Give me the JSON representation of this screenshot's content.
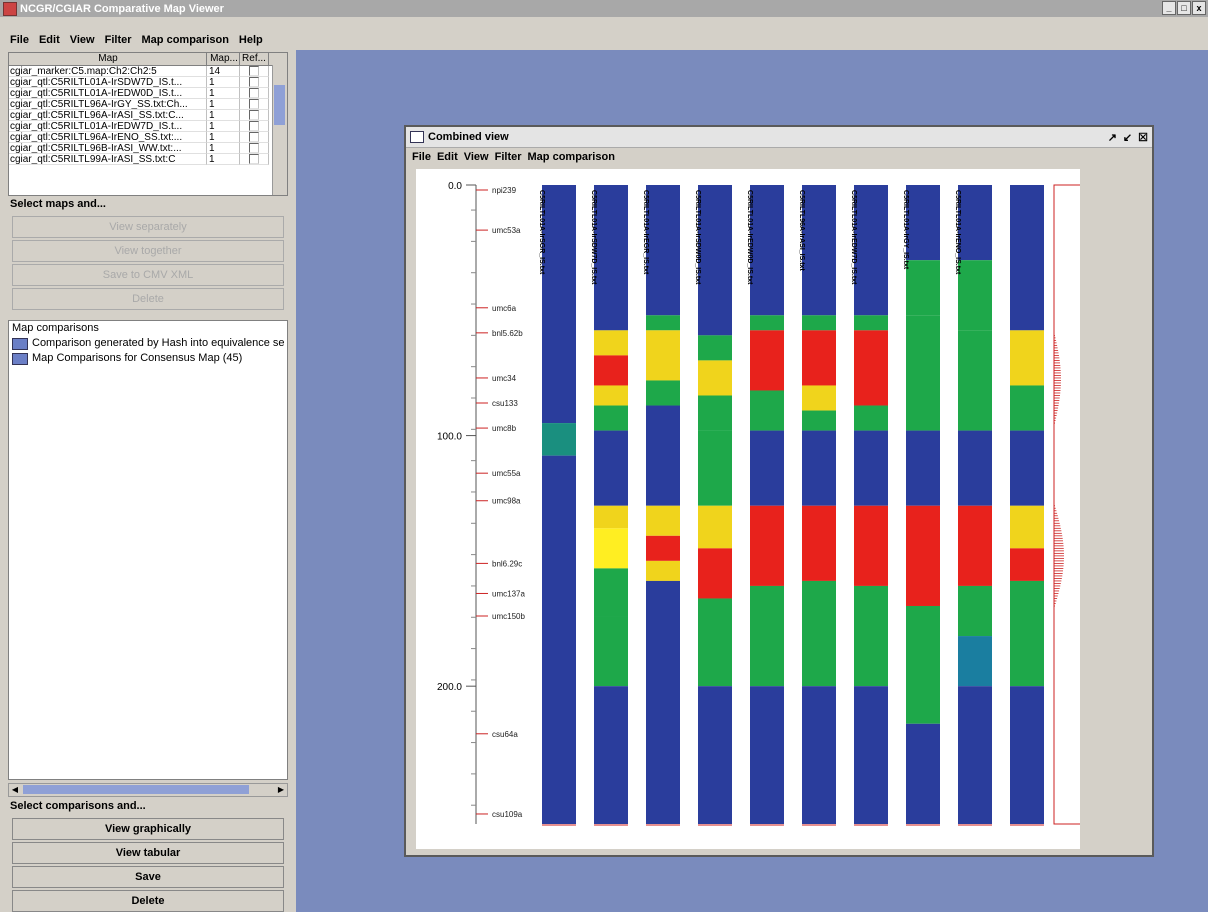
{
  "app": {
    "title": "NCGR/CGIAR Comparative Map Viewer",
    "window_controls": [
      "_",
      "□",
      "x"
    ]
  },
  "menu": [
    "File",
    "Edit",
    "View",
    "Filter",
    "Map comparison",
    "Help"
  ],
  "maps_table": {
    "columns": [
      "Map",
      "Map...",
      "Ref..."
    ],
    "rows": [
      {
        "map": "cgiar_marker:C5.map:Ch2:Ch2:5",
        "count": "14"
      },
      {
        "map": "cgiar_qtl:C5RILTL01A-IrSDW7D_IS.t...",
        "count": "1"
      },
      {
        "map": "cgiar_qtl:C5RILTL01A-IrEDW0D_IS.t...",
        "count": "1"
      },
      {
        "map": "cgiar_qtl:C5RILTL96A-IrGY_SS.txt:Ch...",
        "count": "1"
      },
      {
        "map": "cgiar_qtl:C5RILTL96A-IrASI_SS.txt:C...",
        "count": "1"
      },
      {
        "map": "cgiar_qtl:C5RILTL01A-IrEDW7D_IS.t...",
        "count": "1"
      },
      {
        "map": "cgiar_qtl:C5RILTL96A-IrENO_SS.txt:...",
        "count": "1"
      },
      {
        "map": "cgiar_qtl:C5RILTL96B-IrASI_WW.txt:...",
        "count": "1"
      },
      {
        "map": "cgiar_qtl:C5RILTL99A-IrASI_SS.txt:C",
        "count": "1"
      }
    ]
  },
  "select_maps": {
    "label": "Select maps and...",
    "buttons": [
      "View separately",
      "View together",
      "Save to CMV XML",
      "Delete"
    ]
  },
  "comparisons": {
    "root": "Map comparisons",
    "items": [
      "Comparison generated by Hash into equivalence se",
      "Map Comparisons for Consensus Map (45)"
    ]
  },
  "select_comparisons": {
    "label": "Select comparisons and...",
    "buttons": [
      "View graphically",
      "View tabular",
      "Save",
      "Delete"
    ]
  },
  "combined_view": {
    "title": "Combined view",
    "controls": [
      "↗",
      "↙",
      "☒"
    ],
    "menu": [
      "File",
      "Edit",
      "View",
      "Filter",
      "Map comparison"
    ]
  },
  "chart_data": {
    "type": "heatmap",
    "y_range": [
      0,
      255
    ],
    "y_ticks": [
      {
        "v": 0,
        "label": "0.0"
      },
      {
        "v": 100,
        "label": "100.0"
      },
      {
        "v": 200,
        "label": "200.0"
      }
    ],
    "markers": [
      {
        "pos": 2,
        "name": "npi239"
      },
      {
        "pos": 18,
        "name": "umc53a"
      },
      {
        "pos": 49,
        "name": "umc6a"
      },
      {
        "pos": 59,
        "name": "bnl5.62b"
      },
      {
        "pos": 77,
        "name": "umc34"
      },
      {
        "pos": 87,
        "name": "csu133"
      },
      {
        "pos": 97,
        "name": "umc8b"
      },
      {
        "pos": 115,
        "name": "umc55a"
      },
      {
        "pos": 126,
        "name": "umc98a"
      },
      {
        "pos": 151,
        "name": "bnl6.29c"
      },
      {
        "pos": 163,
        "name": "umc137a"
      },
      {
        "pos": 172,
        "name": "umc150b"
      },
      {
        "pos": 219,
        "name": "csu64a"
      },
      {
        "pos": 251,
        "name": "csu109a"
      }
    ],
    "columns": [
      {
        "label": "C5RILTL01A-IrSGR_IS.txt",
        "segments": [
          [
            0,
            95,
            "#2a3d9c"
          ],
          [
            95,
            108,
            "#1a8f7f"
          ],
          [
            108,
            255,
            "#2a3d9c"
          ]
        ]
      },
      {
        "label": "C5RILTL01A-IrSDW7D_IS.txt",
        "segments": [
          [
            0,
            58,
            "#2a3d9c"
          ],
          [
            58,
            68,
            "#f0d41c"
          ],
          [
            68,
            80,
            "#e8221c"
          ],
          [
            80,
            88,
            "#f0d41c"
          ],
          [
            88,
            98,
            "#1ea84a"
          ],
          [
            98,
            128,
            "#2a3d9c"
          ],
          [
            128,
            137,
            "#f0d41c"
          ],
          [
            137,
            153,
            "#ffee22"
          ],
          [
            153,
            172,
            "#1ea84a"
          ],
          [
            172,
            200,
            "#1ea84a"
          ],
          [
            200,
            255,
            "#2a3d9c"
          ]
        ]
      },
      {
        "label": "C5RILTL01A-IrEGR_IS.txt",
        "segments": [
          [
            0,
            52,
            "#2a3d9c"
          ],
          [
            52,
            58,
            "#1ea84a"
          ],
          [
            58,
            78,
            "#f0d41c"
          ],
          [
            78,
            88,
            "#1ea84a"
          ],
          [
            88,
            128,
            "#2a3d9c"
          ],
          [
            128,
            140,
            "#f0d41c"
          ],
          [
            140,
            150,
            "#e8221c"
          ],
          [
            150,
            158,
            "#f0d41c"
          ],
          [
            158,
            255,
            "#2a3d9c"
          ]
        ]
      },
      {
        "label": "C5RILTL01A-IrSDW0D_IS.txt",
        "segments": [
          [
            0,
            60,
            "#2a3d9c"
          ],
          [
            60,
            70,
            "#1ea84a"
          ],
          [
            70,
            84,
            "#f0d41c"
          ],
          [
            84,
            98,
            "#1ea84a"
          ],
          [
            98,
            128,
            "#1ea84a"
          ],
          [
            128,
            145,
            "#f0d41c"
          ],
          [
            145,
            165,
            "#e8221c"
          ],
          [
            165,
            200,
            "#1ea84a"
          ],
          [
            200,
            255,
            "#2a3d9c"
          ]
        ]
      },
      {
        "label": "C5RILTL01A-IrEDW0D_IS.txt",
        "segments": [
          [
            0,
            52,
            "#2a3d9c"
          ],
          [
            52,
            58,
            "#1ea84a"
          ],
          [
            58,
            82,
            "#e8221c"
          ],
          [
            82,
            98,
            "#1ea84a"
          ],
          [
            98,
            128,
            "#2a3d9c"
          ],
          [
            128,
            160,
            "#e8221c"
          ],
          [
            160,
            200,
            "#1ea84a"
          ],
          [
            200,
            255,
            "#2a3d9c"
          ]
        ]
      },
      {
        "label": "C5RILTL96A-IrASI_IS.txt",
        "segments": [
          [
            0,
            52,
            "#2a3d9c"
          ],
          [
            52,
            58,
            "#1ea84a"
          ],
          [
            58,
            80,
            "#e8221c"
          ],
          [
            80,
            90,
            "#f0d41c"
          ],
          [
            90,
            98,
            "#1ea84a"
          ],
          [
            98,
            128,
            "#2a3d9c"
          ],
          [
            128,
            158,
            "#e8221c"
          ],
          [
            158,
            200,
            "#1ea84a"
          ],
          [
            200,
            255,
            "#2a3d9c"
          ]
        ]
      },
      {
        "label": "C5RILTL01A-IrEDW7D_IS.txt",
        "segments": [
          [
            0,
            52,
            "#2a3d9c"
          ],
          [
            52,
            58,
            "#1ea84a"
          ],
          [
            58,
            88,
            "#e8221c"
          ],
          [
            88,
            98,
            "#1ea84a"
          ],
          [
            98,
            128,
            "#2a3d9c"
          ],
          [
            128,
            160,
            "#e8221c"
          ],
          [
            160,
            200,
            "#1ea84a"
          ],
          [
            200,
            255,
            "#2a3d9c"
          ]
        ]
      },
      {
        "label": "C5RILTL01A-IrGY_IS.txt",
        "segments": [
          [
            0,
            30,
            "#2a3d9c"
          ],
          [
            30,
            52,
            "#1ea84a"
          ],
          [
            52,
            98,
            "#1ea84a"
          ],
          [
            98,
            128,
            "#2a3d9c"
          ],
          [
            128,
            168,
            "#e8221c"
          ],
          [
            168,
            215,
            "#1ea84a"
          ],
          [
            215,
            255,
            "#2a3d9c"
          ]
        ]
      },
      {
        "label": "C5RILTL01A-IrENO_IS.txt",
        "segments": [
          [
            0,
            30,
            "#2a3d9c"
          ],
          [
            30,
            58,
            "#1ea84a"
          ],
          [
            58,
            98,
            "#1ea84a"
          ],
          [
            98,
            128,
            "#2a3d9c"
          ],
          [
            128,
            160,
            "#e8221c"
          ],
          [
            160,
            180,
            "#1ea84a"
          ],
          [
            180,
            200,
            "#1a7ea0"
          ],
          [
            200,
            255,
            "#2a3d9c"
          ]
        ]
      },
      {
        "label": "",
        "segments": [
          [
            0,
            58,
            "#2a3d9c"
          ],
          [
            58,
            80,
            "#f0d41c"
          ],
          [
            80,
            98,
            "#1ea84a"
          ],
          [
            98,
            128,
            "#2a3d9c"
          ],
          [
            128,
            145,
            "#f0d41c"
          ],
          [
            145,
            158,
            "#e8221c"
          ],
          [
            158,
            200,
            "#1ea84a"
          ],
          [
            200,
            255,
            "#2a3d9c"
          ]
        ]
      }
    ],
    "summary_column": {
      "outline": "#cc2222"
    }
  }
}
